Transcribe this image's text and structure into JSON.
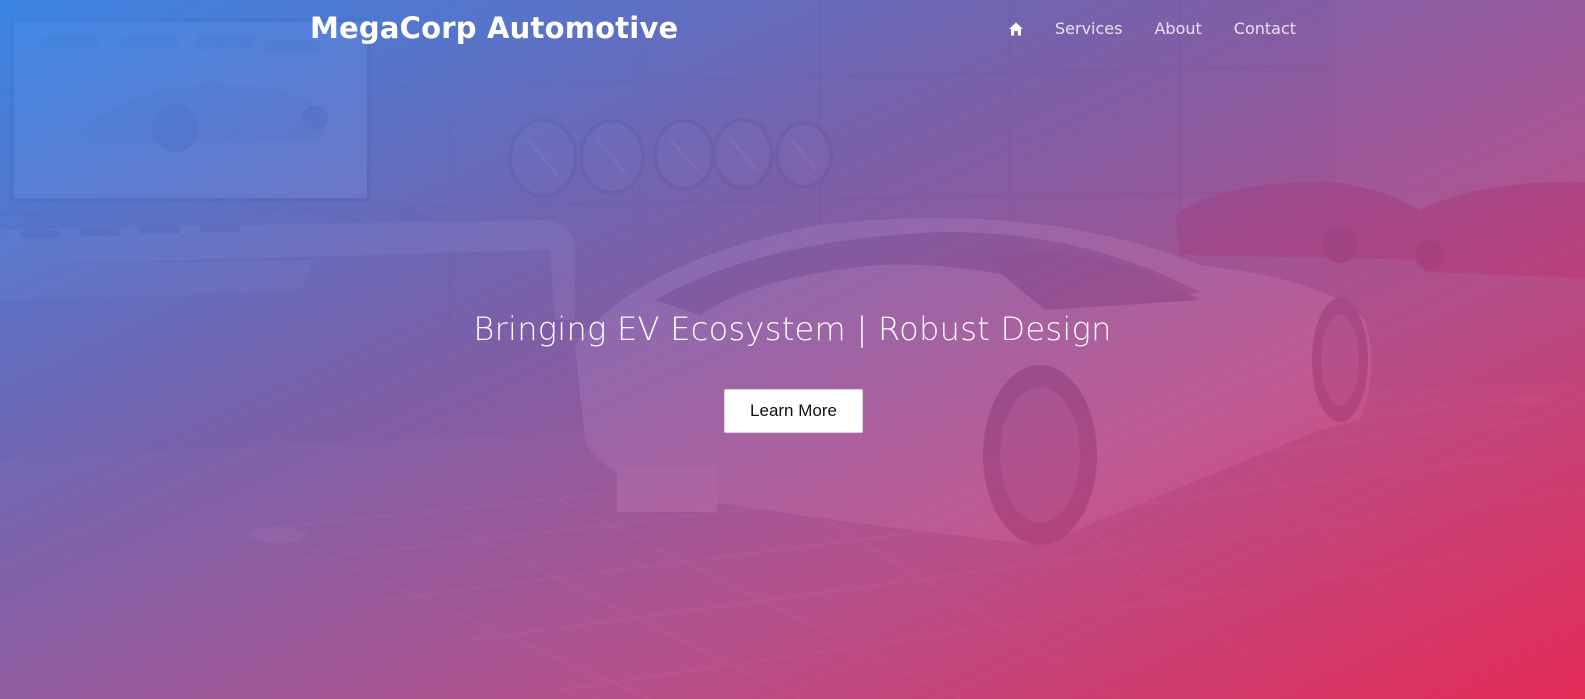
{
  "brand": {
    "name": "MegaCorp Automotive"
  },
  "nav": {
    "home_icon": "home-icon",
    "links": [
      {
        "label": "Services"
      },
      {
        "label": "About"
      },
      {
        "label": "Contact"
      }
    ]
  },
  "hero": {
    "headline": "Bringing EV Ecosystem | Robust Design",
    "cta_label": "Learn More",
    "background_image": "car-showroom-photo"
  },
  "colors": {
    "gradient_start": "#3384e8",
    "gradient_mid": "#7556aa",
    "gradient_end": "#e82552",
    "text": "#ffffff",
    "button_bg": "#ffffff",
    "button_text": "#111111"
  }
}
